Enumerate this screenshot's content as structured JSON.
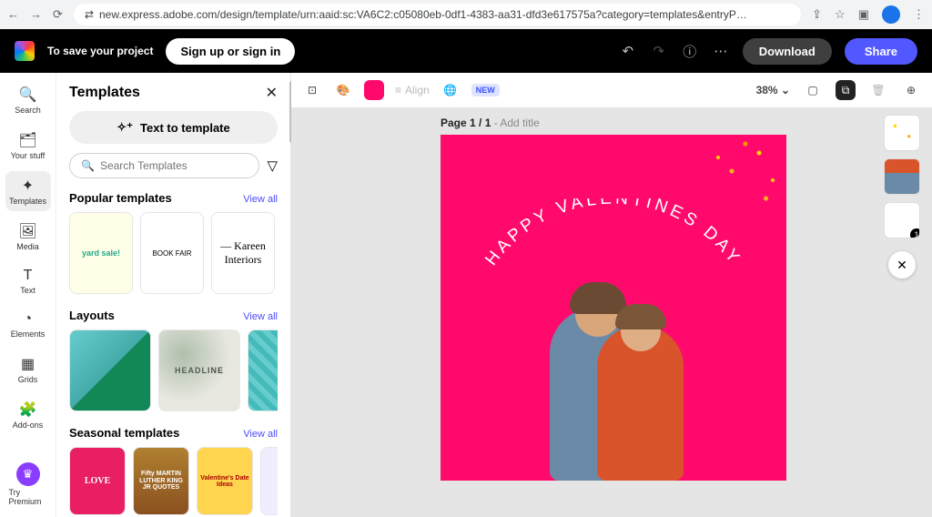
{
  "browser": {
    "url": "new.express.adobe.com/design/template/urn:aaid:sc:VA6C2:c05080eb-0df1-4383-aa31-dfd3e617575a?category=templates&entryP…",
    "lock_icon": "⇄"
  },
  "header": {
    "save_text": "To save your project",
    "signup": "Sign up or sign in",
    "download": "Download",
    "share": "Share"
  },
  "rail": {
    "search": "Search",
    "your_stuff": "Your stuff",
    "templates": "Templates",
    "media": "Media",
    "text": "Text",
    "elements": "Elements",
    "grids": "Grids",
    "addons": "Add-ons",
    "premium": "Try Premium"
  },
  "panel": {
    "title": "Templates",
    "text_to_template": "Text to template",
    "search_placeholder": "Search Templates",
    "viewall": "View all",
    "sections": {
      "popular": "Popular templates",
      "layouts": "Layouts",
      "seasonal": "Seasonal templates"
    },
    "thumbs": {
      "popular1": "yard sale!",
      "popular2": "BOOK FAIR",
      "popular3": "— Kareen Interiors",
      "layout2": "HEADLINE",
      "seasonal1": "LOVE",
      "seasonal2": "Fifty MARTIN LUTHER KING JR QUOTES",
      "seasonal3": "Valentine's Date Ideas"
    }
  },
  "actionbar": {
    "align": "Align",
    "new": "NEW",
    "zoom": "38%"
  },
  "canvas": {
    "page_prefix": "Page 1 / 1",
    "page_suffix": " - Add title",
    "headline": "HAPPY VALENTINES DAY"
  },
  "mini_count": "1",
  "colors": {
    "artboard_bg": "#ff0a6c",
    "share_btn": "#5258ff"
  }
}
